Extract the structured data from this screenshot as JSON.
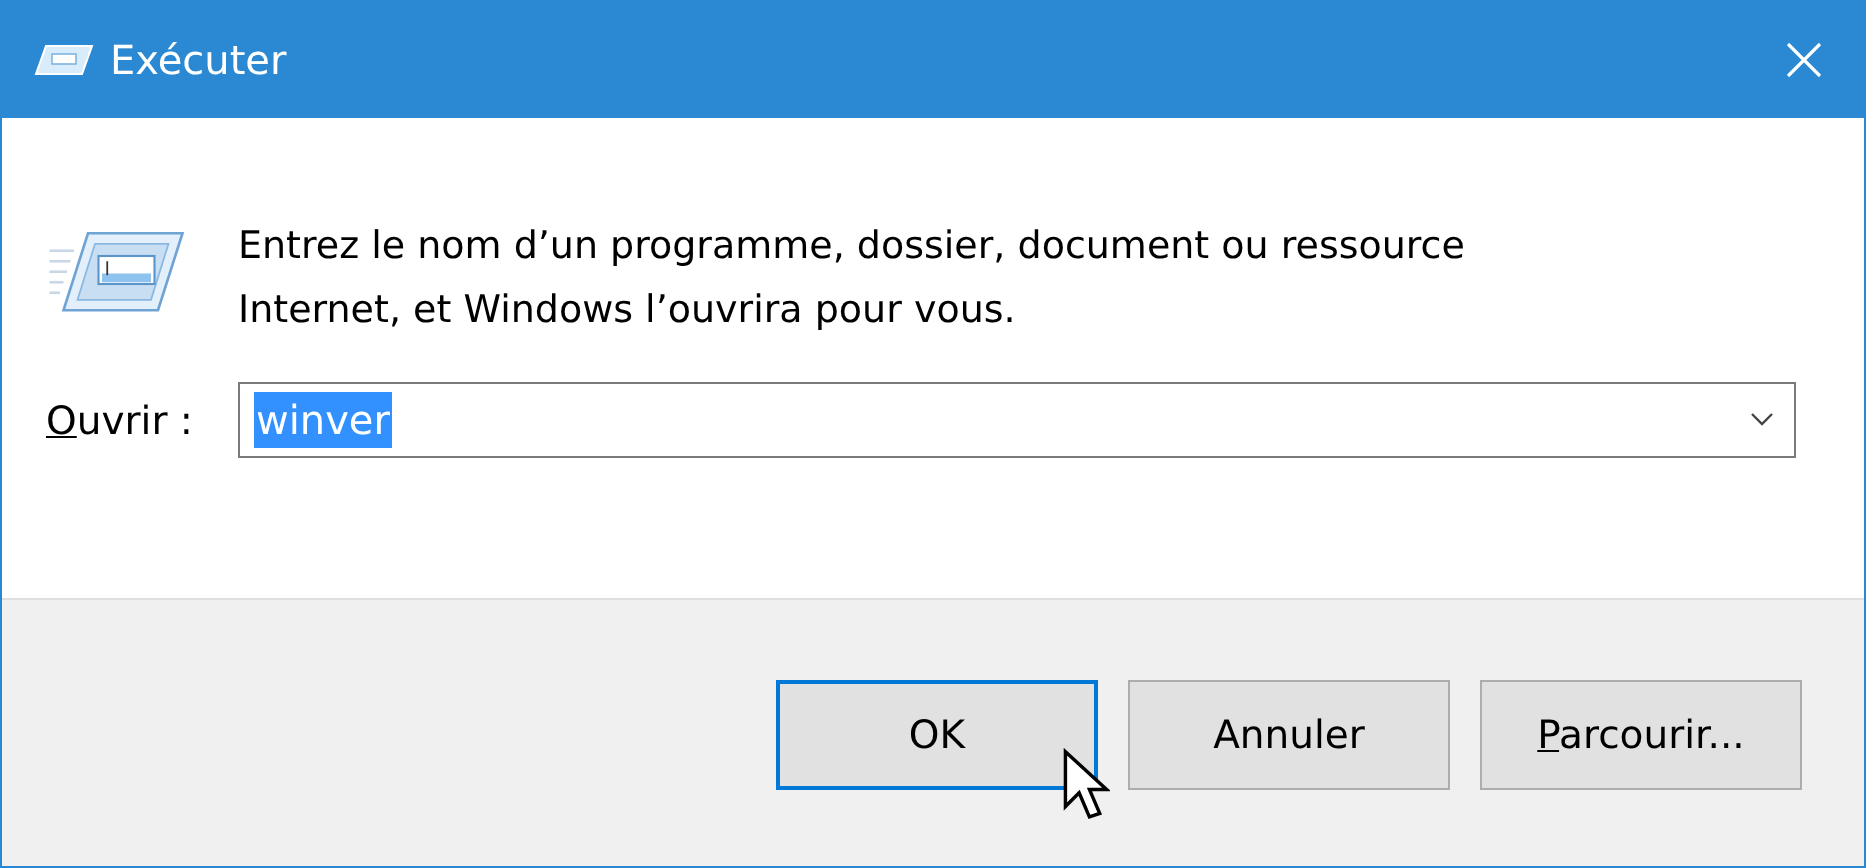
{
  "window": {
    "title": "Exécuter"
  },
  "message": "Entrez le nom d’un programme, dossier, document ou ressource Internet, et Windows l’ouvrira pour vous.",
  "open_field": {
    "label": "Ouvrir :",
    "label_access_key_first": true,
    "value": "winver",
    "value_selected": true
  },
  "buttons": [
    {
      "label": "OK",
      "default": true,
      "access_key_first": false,
      "cursor_over": true
    },
    {
      "label": "Annuler",
      "default": false,
      "access_key_first": false,
      "cursor_over": false
    },
    {
      "label": "Parcourir...",
      "default": false,
      "access_key_first": true,
      "cursor_over": false
    }
  ]
}
